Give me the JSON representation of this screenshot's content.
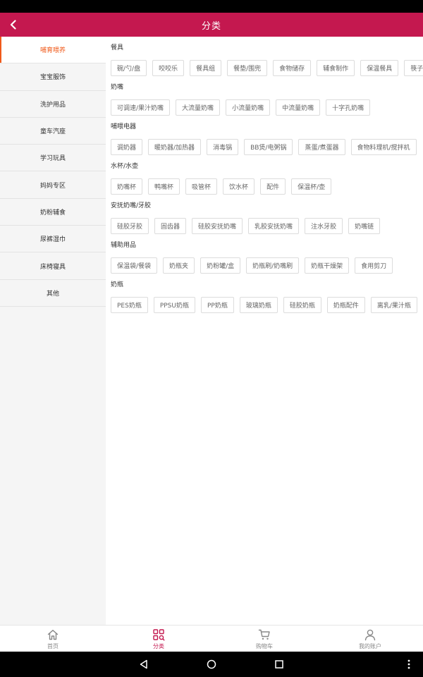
{
  "header": {
    "title": "分类"
  },
  "sidebar": {
    "items": [
      {
        "label": "哺育喂养"
      },
      {
        "label": "宝宝服饰"
      },
      {
        "label": "洗护用品"
      },
      {
        "label": "童车汽座"
      },
      {
        "label": "学习玩具"
      },
      {
        "label": "妈妈专区"
      },
      {
        "label": "奶粉辅食"
      },
      {
        "label": "尿裤湿巾"
      },
      {
        "label": "床椅寝具"
      },
      {
        "label": "其他"
      }
    ]
  },
  "sections": [
    {
      "title": "餐具",
      "tags": [
        "碗/勺/盘",
        "咬咬乐",
        "餐具组",
        "餐垫/围兜",
        "食物储存",
        "辅食制作",
        "保温餐具",
        "筷子"
      ]
    },
    {
      "title": "奶嘴",
      "tags": [
        "可调速/果汁奶嘴",
        "大流量奶嘴",
        "小流量奶嘴",
        "中流量奶嘴",
        "十字孔奶嘴"
      ]
    },
    {
      "title": "哺喂电器",
      "tags": [
        "调奶器",
        "暖奶器/加热器",
        "消毒锅",
        "BB煲/电粥锅",
        "蒸蛋/煮蛋器",
        "食物料理机/搅拌机"
      ]
    },
    {
      "title": "水杯/水壶",
      "tags": [
        "奶嘴杯",
        "鸭嘴杯",
        "吸管杯",
        "饮水杯",
        "配件",
        "保温杯/壶"
      ]
    },
    {
      "title": "安抚奶嘴/牙胶",
      "tags": [
        "硅胶牙胶",
        "固齿器",
        "硅胶安抚奶嘴",
        "乳胶安抚奶嘴",
        "注水牙胶",
        "奶嘴链"
      ]
    },
    {
      "title": "辅助用品",
      "tags": [
        "保温袋/餐袋",
        "奶瓶夹",
        "奶粉罐/盒",
        "奶瓶刷/奶嘴刷",
        "奶瓶干燥架",
        "食用剪刀"
      ]
    },
    {
      "title": "奶瓶",
      "tags": [
        "PES奶瓶",
        "PPSU奶瓶",
        "PP奶瓶",
        "玻璃奶瓶",
        "硅胶奶瓶",
        "奶瓶配件",
        "离乳/果汁瓶"
      ]
    }
  ],
  "tabbar": {
    "items": [
      {
        "label": "首页",
        "icon": "home-icon"
      },
      {
        "label": "分类",
        "icon": "category-icon"
      },
      {
        "label": "购物车",
        "icon": "cart-icon"
      },
      {
        "label": "我的账户",
        "icon": "user-icon"
      }
    ]
  },
  "colors": {
    "brand": "#c4184f",
    "active_side": "#f05a1a"
  }
}
